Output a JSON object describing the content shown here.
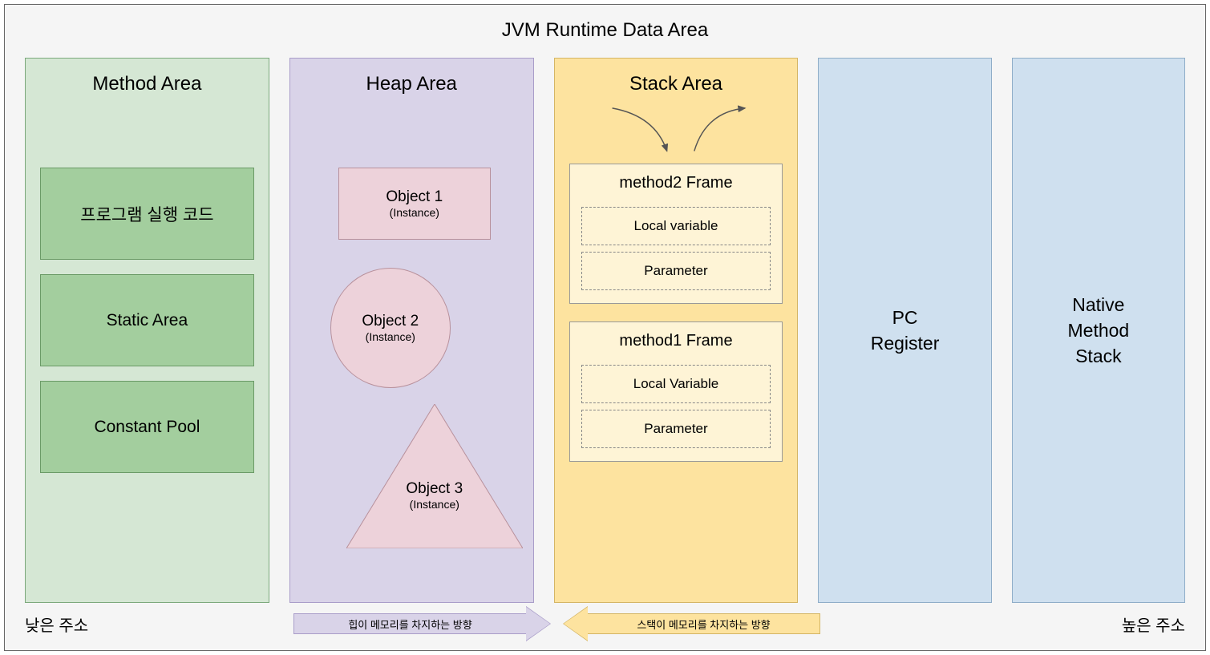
{
  "title": "JVM Runtime Data Area",
  "method_area": {
    "title": "Method Area",
    "items": [
      "프로그램 실행 코드",
      "Static Area",
      "Constant Pool"
    ]
  },
  "heap_area": {
    "title": "Heap Area",
    "objects": [
      {
        "name": "Object 1",
        "sub": "(Instance)"
      },
      {
        "name": "Object 2",
        "sub": "(Instance)"
      },
      {
        "name": "Object 3",
        "sub": "(Instance)"
      }
    ]
  },
  "stack_area": {
    "title": "Stack Area",
    "frames": [
      {
        "title": "method2 Frame",
        "slots": [
          "Local variable",
          "Parameter"
        ]
      },
      {
        "title": "method1 Frame",
        "slots": [
          "Local Variable",
          "Parameter"
        ]
      }
    ]
  },
  "pc_register": {
    "title": "PC\nRegister"
  },
  "native_stack": {
    "title": "Native\nMethod\nStack"
  },
  "labels": {
    "low_addr": "낮은 주소",
    "high_addr": "높은 주소",
    "heap_direction": "힙이 메모리를 차지하는 방향",
    "stack_direction": "스택이 메모리를 차지하는 방향"
  }
}
